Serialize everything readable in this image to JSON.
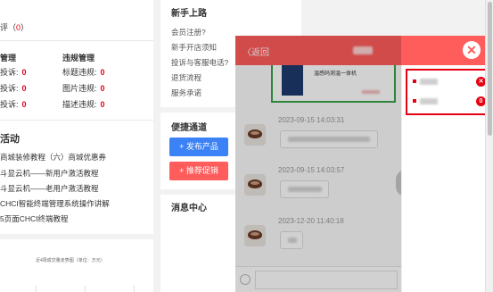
{
  "left": {
    "review_label": "评",
    "review_value": "0",
    "col1_header": "管理",
    "col2_header": "违规管理",
    "rows": [
      {
        "l_label": "投诉:",
        "l_value": "0",
        "r_label": "标题违规:",
        "r_value": "0"
      },
      {
        "l_label": "投诉:",
        "l_value": "0",
        "r_label": "图片违规:",
        "r_value": "0"
      },
      {
        "l_label": "投诉:",
        "l_value": "0",
        "r_label": "描述违规:",
        "r_value": "0"
      }
    ],
    "activity_title": "活动",
    "activity_items": [
      "商城装修教程（六）商城优惠券",
      "斗显云机——新用户激活教程",
      "斗显云机——老用户激活教程",
      "CHCI智能终端管理系统操作讲解",
      "5页面CHCI终端教程"
    ],
    "chart_caption": "近4周成交量走势图（单位：万元）"
  },
  "middle": {
    "guide_title": "新手上路",
    "guide_links": [
      "会员注册?",
      "新手开店须知",
      "投诉与客服电话?",
      "退货流程",
      "服务承诺"
    ],
    "quick_title": "便捷通道",
    "publish_label": "+ 发布产品",
    "promo_label": "+ 推荐促销",
    "msg_title": "消息中心"
  },
  "modal": {
    "back_label": "〈返回",
    "close_label": "✕",
    "product_name": "温感码测温一体机",
    "messages": [
      {
        "time": "2023-09-15 14:03:31"
      },
      {
        "time": "2023-09-15 14:03:57"
      },
      {
        "time": "2023-12-20 11:40:18"
      }
    ],
    "next_label": "›",
    "contacts": [
      {
        "badge": "✕"
      },
      {
        "badge": "0"
      }
    ]
  }
}
